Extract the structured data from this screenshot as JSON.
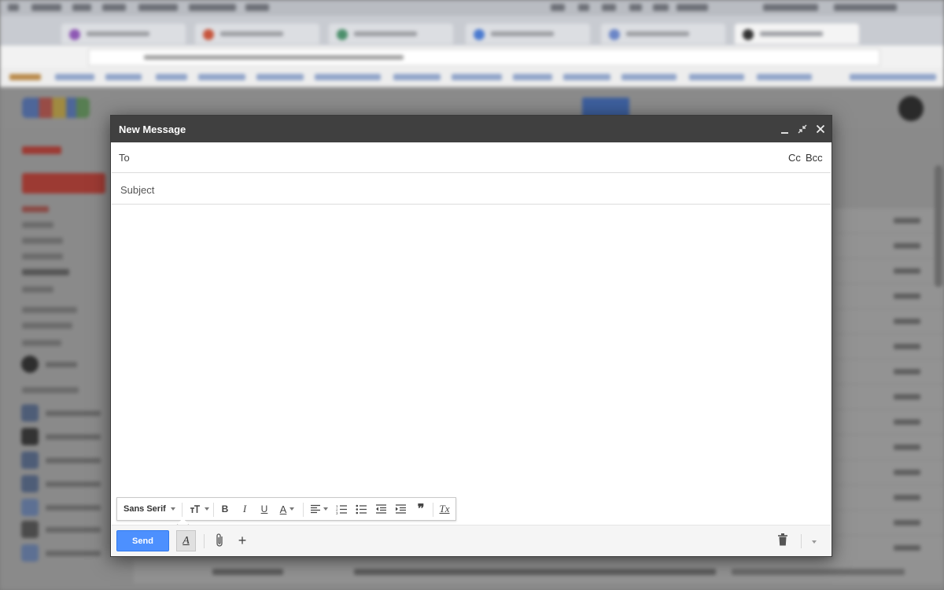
{
  "compose": {
    "title": "New Message",
    "to_label": "To",
    "to_value": "",
    "cc_label": "Cc",
    "bcc_label": "Bcc",
    "subject_placeholder": "Subject",
    "subject_value": "",
    "body_value": ""
  },
  "toolbar": {
    "font_family": "Sans Serif",
    "bold_glyph": "B",
    "italic_glyph": "I",
    "underline_glyph": "U",
    "text_color_glyph": "A",
    "quote_glyph": "❞",
    "remove_format_glyph": "Tx"
  },
  "actions": {
    "send_label": "Send",
    "formatting_glyph": "A",
    "more_glyph": "+"
  },
  "colors": {
    "header_bg": "#404040",
    "send_button": "#4d90fe",
    "gmail_red": "#dd4b39"
  }
}
